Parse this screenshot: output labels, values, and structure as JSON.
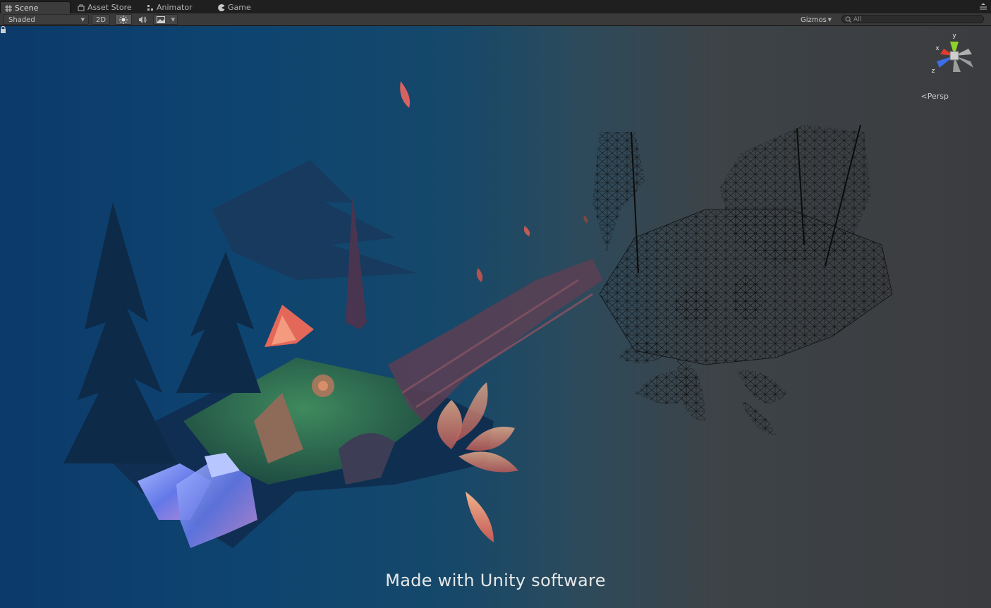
{
  "tabs": [
    {
      "label": "Scene",
      "icon": "grid-icon",
      "active": true
    },
    {
      "label": "Asset Store",
      "icon": "store-icon",
      "active": false
    },
    {
      "label": "Animator",
      "icon": "animator-icon",
      "active": false
    },
    {
      "label": "Game",
      "icon": "pacman-icon",
      "active": false
    }
  ],
  "toolbar": {
    "shading_mode": "Shaded",
    "mode_2d": "2D",
    "gizmos_label": "Gizmos",
    "search_placeholder": "All"
  },
  "scene": {
    "projection_label": "Persp",
    "gizmo_axes": {
      "x": "x",
      "y": "y",
      "z": "z"
    },
    "watermark": "Made with Unity software"
  },
  "colors": {
    "axis_x": "#e03c2c",
    "axis_y": "#8fd12c",
    "axis_z": "#3d6ee8",
    "grass": "#2f6b4a",
    "crystal": "#6e8cff",
    "leaf": "#d8705a"
  }
}
